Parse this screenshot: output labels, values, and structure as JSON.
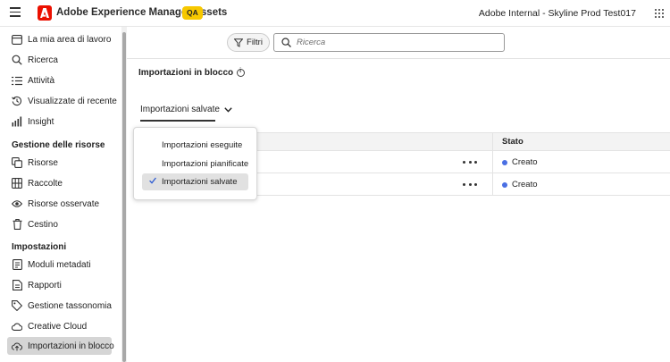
{
  "topbar": {
    "app_title": "Adobe Experience Manager Assets",
    "env_badge": "QA",
    "org_name": "Adobe Internal - Skyline Prod Test017",
    "brand_color": "#eb1000",
    "badge_color": "#f7c800"
  },
  "sidebar": {
    "items": [
      {
        "label": "La mia area di lavoro",
        "icon": "workspace-icon"
      },
      {
        "label": "Ricerca",
        "icon": "search-icon"
      },
      {
        "label": "Attività",
        "icon": "tasks-icon"
      },
      {
        "label": "Visualizzate di recente",
        "icon": "history-icon"
      },
      {
        "label": "Insight",
        "icon": "chart-icon"
      }
    ],
    "section_assets": "Gestione delle risorse",
    "asset_items": [
      {
        "label": "Risorse",
        "icon": "assets-icon"
      },
      {
        "label": "Raccolte",
        "icon": "collections-icon"
      },
      {
        "label": "Risorse osservate",
        "icon": "eye-icon"
      },
      {
        "label": "Cestino",
        "icon": "trash-icon"
      }
    ],
    "section_settings": "Impostazioni",
    "settings_items": [
      {
        "label": "Moduli metadati",
        "icon": "metadata-forms-icon"
      },
      {
        "label": "Rapporti",
        "icon": "reports-icon"
      },
      {
        "label": "Gestione tassonomia",
        "icon": "tag-icon"
      },
      {
        "label": "Creative Cloud",
        "icon": "creative-cloud-icon"
      },
      {
        "label": "Importazioni in blocco",
        "icon": "cloud-upload-icon",
        "active": true
      }
    ]
  },
  "toolbar": {
    "filter_label": "Filtri",
    "search_placeholder": "Ricerca"
  },
  "page": {
    "title": "Importazioni in blocco",
    "view_picker_label": "Importazioni salvate"
  },
  "table": {
    "status_header": "Stato",
    "rows": [
      {
        "status": "Creato",
        "status_color": "#4a6fe3"
      },
      {
        "status": "Creato",
        "status_color": "#4a6fe3"
      }
    ]
  },
  "view_menu": {
    "options": [
      "Importazioni eseguite",
      "Importazioni pianificate",
      "Importazioni salvate"
    ],
    "selected": "Importazioni salvate"
  }
}
